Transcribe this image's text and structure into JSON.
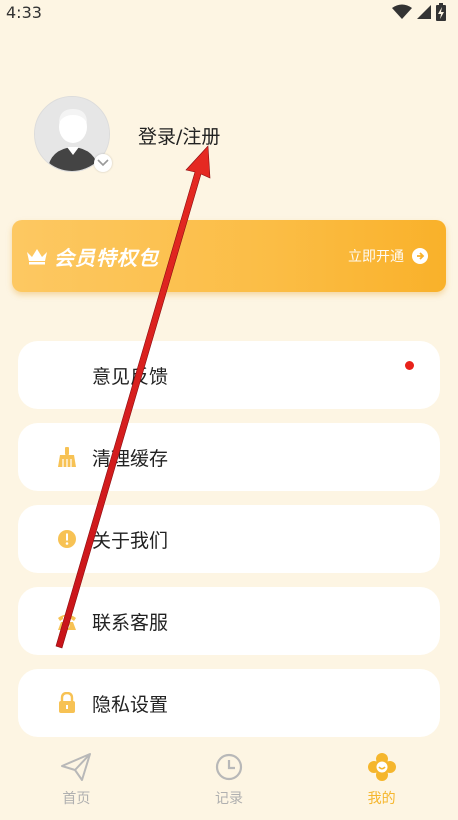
{
  "status_bar": {
    "time": "4:33",
    "wifi_icon": "wifi-icon",
    "signal_icon": "signal-icon",
    "battery_icon": "battery-charging-icon"
  },
  "profile": {
    "avatar_icon": "default-avatar-icon",
    "login_label": "登录/注册"
  },
  "vip_banner": {
    "icon": "crown-icon",
    "title": "会员特权包",
    "action_label": "立即开通",
    "action_icon": "arrow-right-circle-icon",
    "colors": {
      "start": "#fdc862",
      "end": "#f9b12a"
    }
  },
  "menu": {
    "items": [
      {
        "label": "意见反馈",
        "icon": "feedback-icon",
        "has_dot": true
      },
      {
        "label": "清理缓存",
        "icon": "broom-icon"
      },
      {
        "label": "关于我们",
        "icon": "info-icon"
      },
      {
        "label": "联系客服",
        "icon": "phone-icon"
      },
      {
        "label": "隐私设置",
        "icon": "lock-icon"
      }
    ]
  },
  "tab_bar": {
    "tabs": [
      {
        "label": "首页",
        "icon": "paper-plane-icon",
        "active": false
      },
      {
        "label": "记录",
        "icon": "clock-icon",
        "active": false
      },
      {
        "label": "我的",
        "icon": "smile-flower-icon",
        "active": true
      }
    ]
  },
  "colors": {
    "background": "#fdf5e3",
    "accent": "#f5b62d",
    "notification_dot": "#e8221a"
  }
}
